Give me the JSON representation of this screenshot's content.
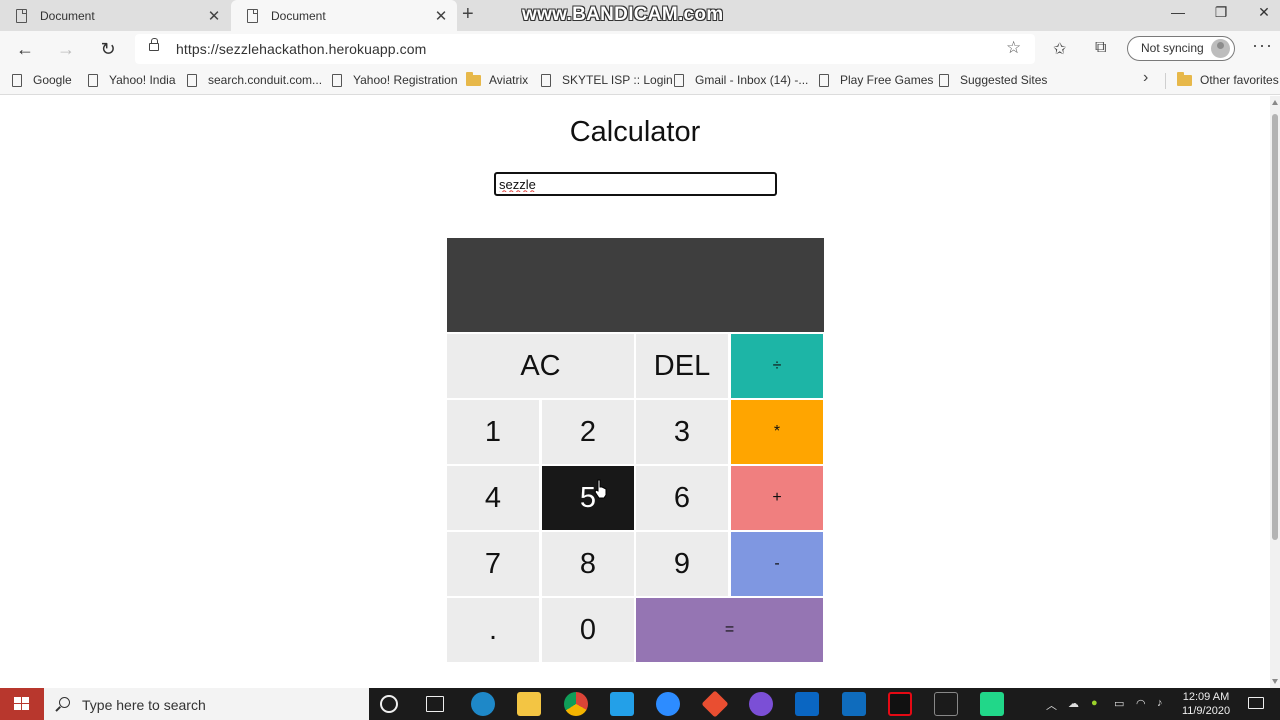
{
  "browser": {
    "tabs": [
      {
        "title": "Document",
        "active": false
      },
      {
        "title": "Document",
        "active": true
      }
    ],
    "watermark": "www.BANDICAM.com",
    "url": "https://sezzlehackathon.herokuapp.com",
    "sync_label": "Not syncing",
    "favorites": [
      {
        "label": "Google",
        "icon": "page-icon"
      },
      {
        "label": "Yahoo! India",
        "icon": "page-icon"
      },
      {
        "label": "search.conduit.com...",
        "icon": "page-icon"
      },
      {
        "label": "Yahoo! Registration",
        "icon": "page-icon"
      },
      {
        "label": "Aviatrix",
        "icon": "folder-icon"
      },
      {
        "label": "SKYTEL ISP :: Login",
        "icon": "page-icon"
      },
      {
        "label": "Gmail - Inbox (14) -...",
        "icon": "page-icon"
      },
      {
        "label": "Play Free Games",
        "icon": "page-icon"
      },
      {
        "label": "Suggested Sites",
        "icon": "page-icon"
      }
    ],
    "other_favorites": "Other favorites"
  },
  "page": {
    "title": "Calculator",
    "name_input_value": "sezzle",
    "display_value": "",
    "keys": {
      "ac": "AC",
      "del": "DEL",
      "divide": "÷",
      "multiply": "*",
      "plus": "+",
      "minus": "-",
      "equals": "=",
      "dot": ".",
      "d0": "0",
      "d1": "1",
      "d2": "2",
      "d3": "3",
      "d4": "4",
      "d5": "5",
      "d6": "6",
      "d7": "7",
      "d8": "8",
      "d9": "9"
    },
    "key_colors": {
      "divide": "#1db5a6",
      "multiply": "#ffa500",
      "plus": "#f07f7f",
      "minus": "#7f97e1",
      "equals": "#9575b3",
      "pressed": "#181818",
      "default": "#ececec",
      "display": "#3e3e3e"
    },
    "pressed_key": "5"
  },
  "taskbar": {
    "search_placeholder": "Type here to search",
    "time": "12:09 AM",
    "date": "11/9/2020"
  }
}
